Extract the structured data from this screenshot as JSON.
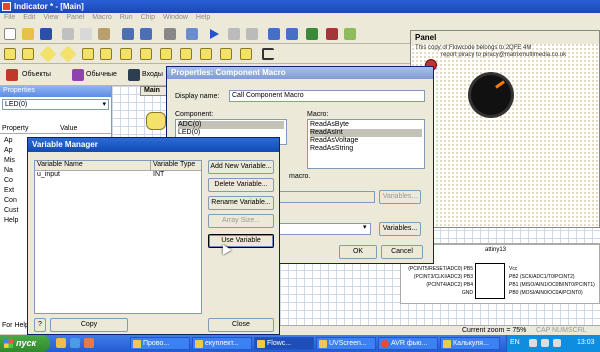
{
  "window": {
    "title": "Indicator * - [Main]"
  },
  "menu": [
    "File",
    "Edit",
    "View",
    "Panel",
    "Macro",
    "Run",
    "Chip",
    "Window",
    "Help"
  ],
  "toolbar3": {
    "objects_label": "Объекты",
    "common_label": "Обычные",
    "inputs_label": "Входы"
  },
  "properties": {
    "header": "Properties",
    "combo_value": "LED(0)",
    "col_property": "Property",
    "col_value": "Value",
    "rows": [
      "Ap",
      "Ap",
      "Mis",
      "Na",
      "Co",
      "Ext",
      "Con",
      "Cust",
      "Help"
    ],
    "footer": "For Help"
  },
  "canvas_tab": "Main",
  "panel": {
    "title": "Panel",
    "copy_line1": "This copy of Flowcode belongs to 2QFE 4M",
    "copy_line2": "report piracy to piracy@matrixmultimedia.co.uk"
  },
  "component_macro": {
    "title": "Properties: Component Macro",
    "display_name_label": "Display name:",
    "display_name_value": "Call Component Macro",
    "component_label": "Component:",
    "components": [
      "ADC(0)",
      "LED(0)"
    ],
    "macro_label": "Macro:",
    "macros": [
      "ReadAsByte",
      "ReadAsInt",
      "ReadAsVoltage",
      "ReadAsString"
    ],
    "selected_macro": "ReadAsInt",
    "macro_note": "macro.",
    "variables_button": "Variables...",
    "variables_button2": "Variables...",
    "ok_label": "OK",
    "cancel_label": "Cancel"
  },
  "variable_manager": {
    "title": "Variable Manager",
    "col_name": "Variable Name",
    "col_type": "Variable Type",
    "rows": [
      {
        "name": "u_input",
        "type": "INT"
      }
    ],
    "buttons": {
      "add": "Add New Variable...",
      "delete": "Delete Variable...",
      "rename": "Rename Variable...",
      "array": "Array Size...",
      "use": "Use Variable",
      "copy": "Copy",
      "close": "Close",
      "help": "?"
    }
  },
  "chip": {
    "name": "attiny13",
    "left_pins": [
      "(PCINT5/RESET/ADC0) PB5",
      "(PCINT3/CLKI/ADC3) PB3",
      "(PCINT4/ADC2) PB4",
      "GND"
    ],
    "right_pins": [
      "Vcc",
      "PB2 (SCK/ADC1/T0/PCINT2)",
      "PB1 (MISO/AIN1/OC0B/INT0/PCINT1)",
      "PB0 (MOSI/AIN0/OC0A/PCINT0)"
    ]
  },
  "status": {
    "zoom": "Current zoom = 75%",
    "caps": "CAP",
    "num": "NUM",
    "scrl": "SCRL"
  },
  "taskbar": {
    "start": "пуск",
    "tasks": [
      "Прово...",
      "екуплект...",
      "Flowc...",
      "UVScreen...",
      "AVR фью...",
      "Калькуля..."
    ],
    "lang": "EN",
    "clock": "13:03"
  },
  "colors": {
    "titlebar": "#1b48b5",
    "taskbar": "#245bd2",
    "start": "#3a9a35",
    "knob": "#111111"
  }
}
